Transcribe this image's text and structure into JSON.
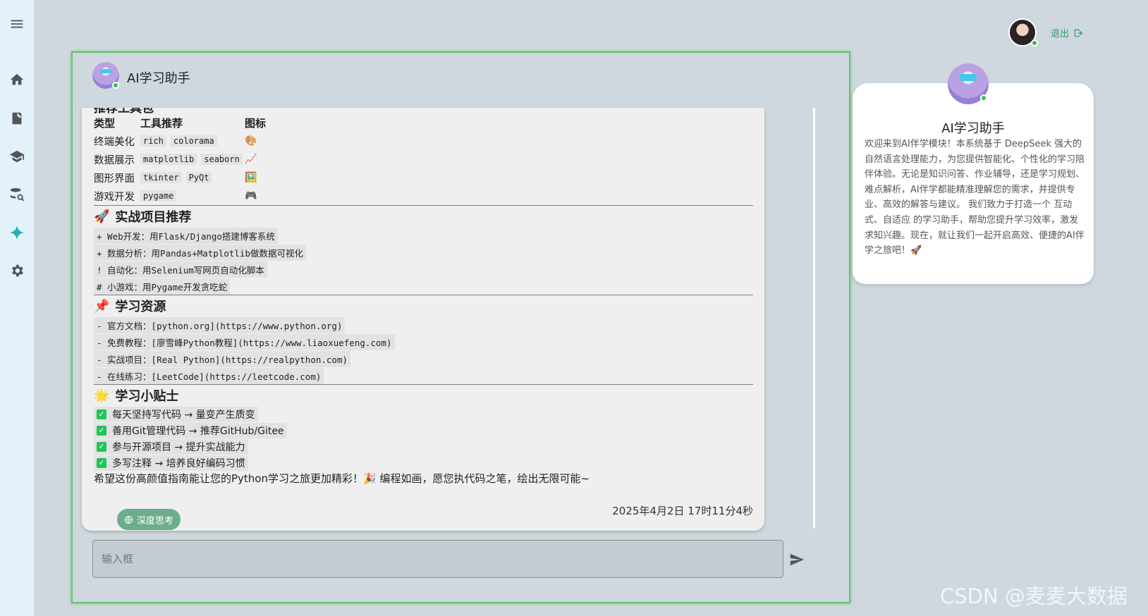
{
  "sidebar": {
    "icons": [
      "menu-icon",
      "home-icon",
      "notebook-icon",
      "school-icon",
      "database-search-icon",
      "sparkle-icon",
      "settings-icon"
    ]
  },
  "topbar": {
    "logout_label": "退出"
  },
  "chat": {
    "title": "AI学习助手",
    "cut_heading": "推荐工具包",
    "table": {
      "headers": [
        "类型",
        "工具推荐",
        "图标"
      ],
      "rows": [
        {
          "type": "终端美化",
          "tools": [
            "rich",
            "colorama"
          ],
          "icon": "🎨"
        },
        {
          "type": "数据展示",
          "tools": [
            "matplotlib",
            "seaborn"
          ],
          "icon": "📈"
        },
        {
          "type": "图形界面",
          "tools": [
            "tkinter",
            "PyQt"
          ],
          "icon": "🖼️"
        },
        {
          "type": "游戏开发",
          "tools": [
            "pygame"
          ],
          "icon": "🎮"
        }
      ]
    },
    "projects": {
      "emoji": "🚀",
      "heading": "实战项目推荐",
      "lines": [
        "+ Web开发：用Flask/Django搭建博客系统",
        "+ 数据分析：用Pandas+Matplotlib做数据可视化",
        "! 自动化：用Selenium写网页自动化脚本",
        "# 小游戏：用Pygame开发贪吃蛇"
      ]
    },
    "resources": {
      "emoji": "📌",
      "heading": "学习资源",
      "lines": [
        "- 官方文档：[python.org](https://www.python.org)",
        "- 免费教程：[廖雪峰Python教程](https://www.liaoxuefeng.com)",
        "- 实战项目：[Real Python](https://realpython.com)",
        "- 在线练习：[LeetCode](https://leetcode.com)"
      ]
    },
    "tips": {
      "emoji": "🌟",
      "heading": "学习小贴士",
      "lines": [
        "每天坚持写代码 → 量变产生质变",
        "善用Git管理代码 → 推荐GitHub/Gitee",
        "参与开源项目 → 提升实战能力",
        "多写注释 → 培养良好编码习惯"
      ]
    },
    "closing": "希望这份高颜值指南能让您的Python学习之旅更加精彩！🎉 编程如画，愿您执代码之笔，绘出无限可能~",
    "timestamp": "2025年4月2日 17时11分4秒",
    "deep_think_label": "深度思考",
    "input_placeholder": "输入框"
  },
  "info_card": {
    "title": "AI学习助手",
    "description": "欢迎来到AI伴学模块！本系统基于 DeepSeek 强大的自然语言处理能力，为您提供智能化、个性化的学习陪伴体验。无论是知识问答、作业辅导，还是学习规划、难点解析，AI伴学都能精准理解您的需求，并提供专业、高效的解答与建议。 我们致力于打造一个 互动式、自适应 的学习助手，帮助您提升学习效率，激发求知兴趣。现在，就让我们一起开启高效、便捷的AI伴学之旅吧！🚀"
  },
  "watermark": "CSDN @麦麦大数据",
  "colors": {
    "accent_green": "#2e9c6c",
    "panel_border": "#63c46d",
    "deep_think_bg": "#6cad8c",
    "check_green": "#21c45b"
  }
}
